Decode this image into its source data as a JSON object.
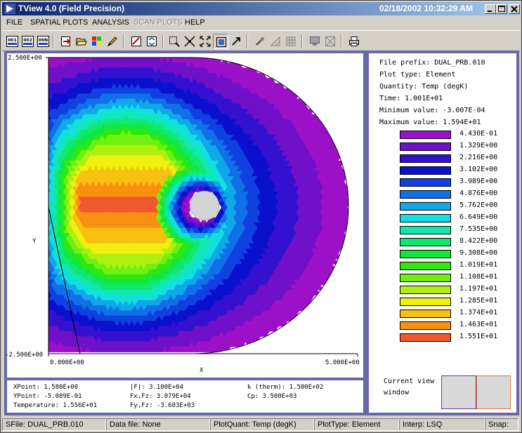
{
  "window": {
    "title": "TView 4.0 (Field Precision)",
    "datetime": "02/18/2002 10:32:29 AM",
    "controls": [
      "minimize-icon",
      "maximize-icon",
      "close-icon"
    ]
  },
  "menu": [
    {
      "label": "FILE",
      "enabled": true
    },
    {
      "label": "SPATIAL PLOTS",
      "enabled": true
    },
    {
      "label": "ANALYSIS",
      "enabled": true
    },
    {
      "label": "SCAN PLOTS",
      "enabled": false
    },
    {
      "label": "HELP",
      "enabled": true
    }
  ],
  "toolbar": {
    "buttons": [
      {
        "name": "file-001-icon",
        "text": "001"
      },
      {
        "name": "file-002-icon",
        "text": "002"
      },
      {
        "name": "file-00n-icon",
        "text": "00N"
      },
      {
        "name": "export-icon"
      },
      {
        "name": "open-folder-icon"
      },
      {
        "name": "palette-icon"
      },
      {
        "name": "pencil-icon"
      },
      {
        "name": "plot-line-icon"
      },
      {
        "name": "plot-refresh-icon"
      },
      {
        "name": "zoom-window-icon"
      },
      {
        "name": "zoom-in-icon"
      },
      {
        "name": "zoom-out-icon"
      },
      {
        "name": "zoom-fit-icon"
      },
      {
        "name": "pan-icon"
      },
      {
        "name": "probe-icon"
      },
      {
        "name": "triangle-mesh-icon"
      },
      {
        "name": "grid-icon"
      },
      {
        "name": "display-icon"
      },
      {
        "name": "clear-icon"
      },
      {
        "name": "printer-icon"
      }
    ]
  },
  "plot": {
    "y_max_label": "2.500E+00",
    "y_min_label": "-2.500E+00",
    "x_min_label": "0.000E+00",
    "x_max_label": "5.000E+00",
    "x_axis_label": "X",
    "y_axis_label": "Y"
  },
  "info": {
    "file_prefix": "File prefix: DUAL_PRB.010",
    "plot_type": "Plot type: Element",
    "quantity": "Quantity: Temp (degK)",
    "time": "Time:   1.001E+01",
    "min_value": "Minimum value:  -3.007E-04",
    "max_value": "Maximum value:   1.594E+01"
  },
  "legend": [
    {
      "color": "#9c10c8",
      "label": "4.430E-01"
    },
    {
      "color": "#7010c8",
      "label": "1.329E+00"
    },
    {
      "color": "#3410d0",
      "label": "2.216E+00"
    },
    {
      "color": "#0a10cc",
      "label": "3.102E+00"
    },
    {
      "color": "#1040e0",
      "label": "3.989E+00"
    },
    {
      "color": "#1070e8",
      "label": "4.876E+00"
    },
    {
      "color": "#10a8e8",
      "label": "5.762E+00"
    },
    {
      "color": "#10e0e0",
      "label": "6.649E+00"
    },
    {
      "color": "#10e8b0",
      "label": "7.535E+00"
    },
    {
      "color": "#10e870",
      "label": "8.422E+00"
    },
    {
      "color": "#10e840",
      "label": "9.308E+00"
    },
    {
      "color": "#30e810",
      "label": "1.019E+01"
    },
    {
      "color": "#70f010",
      "label": "1.108E+01"
    },
    {
      "color": "#b0f010",
      "label": "1.197E+01"
    },
    {
      "color": "#f0f010",
      "label": "1.285E+01"
    },
    {
      "color": "#f8c010",
      "label": "1.374E+01"
    },
    {
      "color": "#f89010",
      "label": "1.463E+01"
    },
    {
      "color": "#f05830",
      "label": "1.551E+01"
    }
  ],
  "current_view": {
    "label": "Current view window"
  },
  "probe": {
    "xpoint": "XPoint:  1.580E+00",
    "ypoint": "YPoint: -5.089E-01",
    "temperature": "Temperature:  1.556E+01",
    "f_mag": "|F|:   3.100E+04",
    "fx": "Fx,Fz:  3.079E+04",
    "fy": "Fy,Fz:  -3.603E+03",
    "k_therm": "k (therm):  1.500E+02",
    "cp": "Cp:   3.500E+03"
  },
  "status": {
    "sfile": "SFile: DUAL_PRB.010",
    "datafile": "Data file: None",
    "plotquant": "PlotQuant: Temp (degK)",
    "plottype": "PlotType: Element",
    "interp": "Interp: LSQ",
    "snap": "Snap:"
  }
}
